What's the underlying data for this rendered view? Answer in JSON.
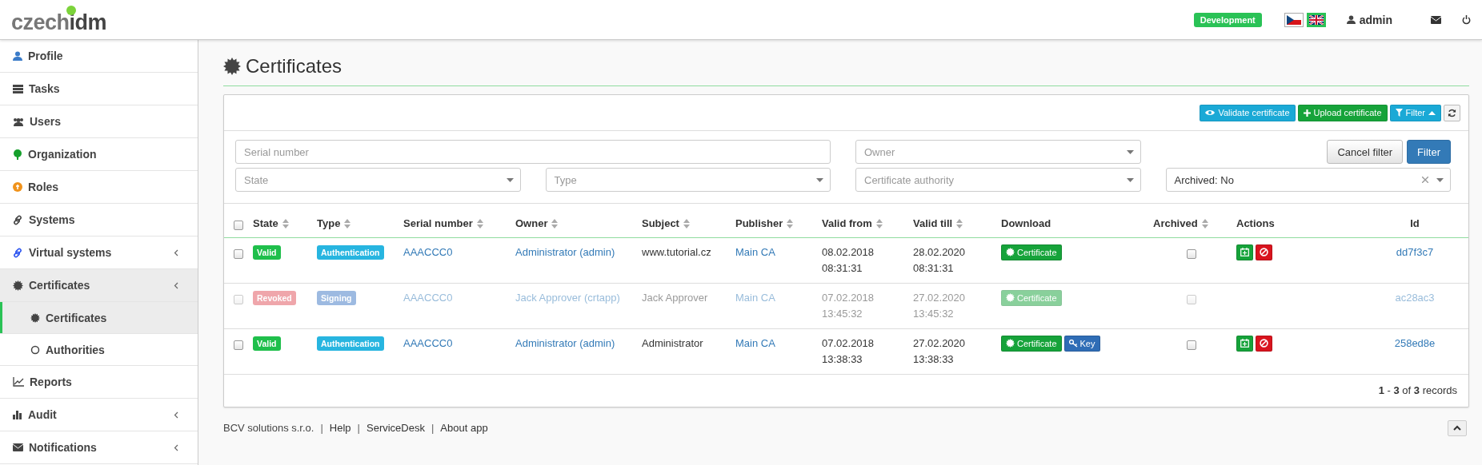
{
  "header": {
    "logo": {
      "first": "czech",
      "second": "idm"
    },
    "environment": "Development",
    "languages": [
      {
        "kind": "cz",
        "selected": false
      },
      {
        "kind": "en",
        "selected": true
      }
    ],
    "user": "admin"
  },
  "sidebar": {
    "items": [
      {
        "label": "Profile",
        "selected": false,
        "submenu": false
      },
      {
        "label": "Tasks",
        "selected": false,
        "submenu": false
      },
      {
        "label": "Users",
        "selected": false,
        "submenu": false
      },
      {
        "label": "Organization",
        "selected": false,
        "submenu": false
      },
      {
        "label": "Roles",
        "selected": false,
        "submenu": false
      },
      {
        "label": "Systems",
        "selected": false,
        "submenu": false
      },
      {
        "label": "Virtual systems",
        "selected": false,
        "submenu": true
      },
      {
        "label": "Certificates",
        "selected": true,
        "submenu": true,
        "children": [
          {
            "label": "Certificates",
            "selected": true
          },
          {
            "label": "Authorities",
            "selected": false
          }
        ]
      },
      {
        "label": "Reports",
        "selected": false,
        "submenu": false
      },
      {
        "label": "Audit",
        "selected": false,
        "submenu": true
      },
      {
        "label": "Notifications",
        "selected": false,
        "submenu": true
      }
    ]
  },
  "page": {
    "title": "Certificates"
  },
  "toolbar": {
    "buttons": [
      {
        "kind": "validate",
        "label": "Validate certificate"
      },
      {
        "kind": "upload",
        "label": "Upload certificate"
      },
      {
        "kind": "filter",
        "label": "Filter",
        "expanded": true
      },
      {
        "kind": "refresh"
      }
    ]
  },
  "filters": {
    "fields": [
      {
        "kind": "input",
        "placeholder": "Serial number"
      },
      {
        "kind": "select",
        "placeholder": "Owner"
      },
      {
        "kind": "select",
        "placeholder": "State"
      },
      {
        "kind": "select",
        "placeholder": "Type"
      },
      {
        "kind": "select",
        "placeholder": "Certificate authority"
      },
      {
        "kind": "select",
        "value": "Archived: No",
        "clearable": true
      }
    ],
    "buttons": [
      {
        "kind": "cancel",
        "label": "Cancel filter"
      },
      {
        "kind": "apply",
        "label": "Filter"
      }
    ]
  },
  "table": {
    "select_all": {
      "checked": false
    },
    "columns": [
      {
        "label": "State",
        "sortable": true
      },
      {
        "label": "Type",
        "sortable": true
      },
      {
        "label": "Serial number",
        "sortable": true
      },
      {
        "label": "Owner",
        "sortable": true
      },
      {
        "label": "Subject",
        "sortable": true
      },
      {
        "label": "Publisher",
        "sortable": true
      },
      {
        "label": "Valid from",
        "sortable": true
      },
      {
        "label": "Valid till",
        "sortable": true
      },
      {
        "label": "Download",
        "sortable": false
      },
      {
        "label": "Archived",
        "sortable": true
      },
      {
        "label": "Actions",
        "sortable": false
      },
      {
        "label": "Id",
        "sortable": false
      }
    ],
    "rows": [
      {
        "checked": false,
        "disabled": false,
        "state": {
          "label": "Valid",
          "kind": "valid"
        },
        "type": {
          "label": "Authentication",
          "kind": "authentication"
        },
        "serial": "AAACCC0",
        "owner": "Administrator (admin)",
        "subject": "www.tutorial.cz",
        "publisher": "Main CA",
        "valid_from": "08.02.2018 08:31:31",
        "valid_till": "28.02.2020 08:31:31",
        "downloads": [
          {
            "kind": "certificate",
            "label": "Certificate"
          }
        ],
        "archived": false,
        "actions": [
          {
            "kind": "renew"
          },
          {
            "kind": "revoke"
          }
        ],
        "id": "dd7f3c7"
      },
      {
        "checked": false,
        "disabled": true,
        "state": {
          "label": "Revoked",
          "kind": "revoked"
        },
        "type": {
          "label": "Signing",
          "kind": "signing"
        },
        "serial": "AAACCC0",
        "owner": "Jack Approver (crtapp)",
        "subject": "Jack Approver",
        "publisher": "Main CA",
        "valid_from": "07.02.2018 13:45:32",
        "valid_till": "27.02.2020 13:45:32",
        "downloads": [
          {
            "kind": "certificate",
            "label": "Certificate"
          }
        ],
        "archived": false,
        "actions": [],
        "id": "ac28ac3"
      },
      {
        "checked": false,
        "disabled": false,
        "state": {
          "label": "Valid",
          "kind": "valid"
        },
        "type": {
          "label": "Authentication",
          "kind": "authentication"
        },
        "serial": "AAACCC0",
        "owner": "Administrator (admin)",
        "subject": "Administrator",
        "publisher": "Main CA",
        "valid_from": "07.02.2018 13:38:33",
        "valid_till": "27.02.2020 13:38:33",
        "downloads": [
          {
            "kind": "certificate",
            "label": "Certificate"
          },
          {
            "kind": "key",
            "label": "Key"
          }
        ],
        "archived": false,
        "actions": [
          {
            "kind": "renew"
          },
          {
            "kind": "revoke"
          }
        ],
        "id": "258ed8e"
      }
    ],
    "records": "**1** - **3** of **3** records"
  },
  "footer": {
    "items": [
      {
        "kind": "text",
        "label": "BCV solutions s.r.o."
      },
      {
        "kind": "separator",
        "label": "|"
      },
      {
        "kind": "link",
        "label": "Help"
      },
      {
        "kind": "separator",
        "label": "|"
      },
      {
        "kind": "link",
        "label": "ServiceDesk"
      },
      {
        "kind": "separator",
        "label": "|"
      },
      {
        "kind": "link",
        "label": "About app"
      }
    ]
  }
}
